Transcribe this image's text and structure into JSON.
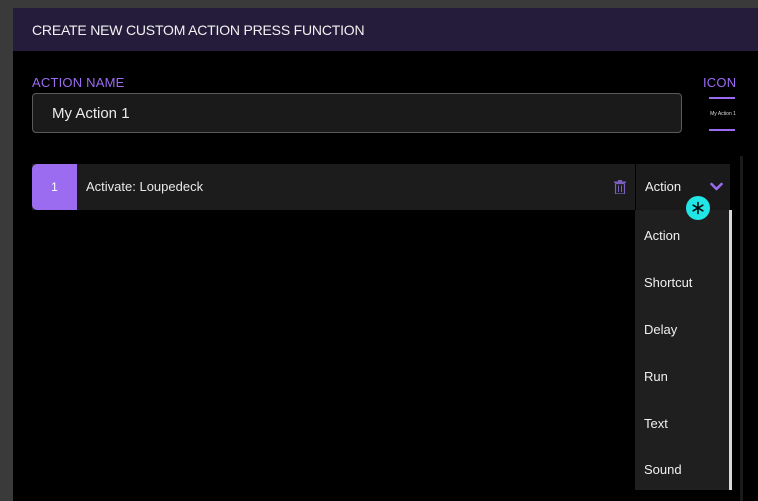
{
  "dialog": {
    "title": "CREATE NEW CUSTOM ACTION PRESS FUNCTION"
  },
  "action_name": {
    "label": "ACTION NAME",
    "value": "My Action 1"
  },
  "icon": {
    "label": "ICON",
    "preview_text": "My Action 1"
  },
  "steps": [
    {
      "number": "1",
      "text": "Activate: Loupedeck",
      "type": "Action"
    }
  ],
  "type_dropdown": {
    "options": [
      "Action",
      "Shortcut",
      "Delay",
      "Run",
      "Text",
      "Sound"
    ]
  },
  "icons": {
    "delete": "trash-icon",
    "expand": "chevron-down-icon",
    "pointer": "cursor-indicator"
  },
  "colors": {
    "accent": "#9b6cf0",
    "header_bg": "#241c3a",
    "background": "#000000",
    "cursor": "#22e6e6"
  }
}
